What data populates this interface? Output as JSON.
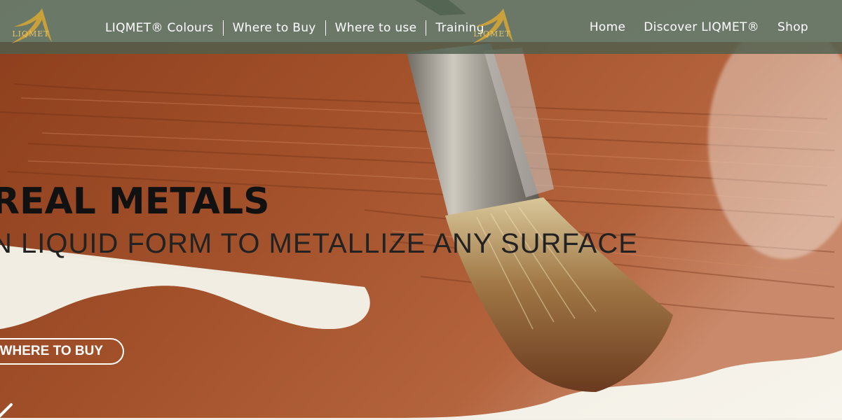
{
  "brand": {
    "logo_text": "LIQMET",
    "accent": "#c9a03a"
  },
  "header": {
    "background": "#4e5f4e",
    "left_nav": [
      {
        "label": "LIQMET® Colours"
      },
      {
        "label": "Where to Buy"
      },
      {
        "label": "Where to use"
      },
      {
        "label": "Training"
      }
    ],
    "right_nav": [
      {
        "label": "Home"
      },
      {
        "label": "Discover LIQMET®"
      },
      {
        "label": "Shop"
      }
    ]
  },
  "hero": {
    "headline": "REAL METALS",
    "subheadline": "N LIQUID FORM TO METALLIZE ANY SURFACE",
    "cta_label": "WHERE TO BUY",
    "paint_color": "#a0522d",
    "icons": {
      "scroll": "chevron-down-icon"
    }
  }
}
